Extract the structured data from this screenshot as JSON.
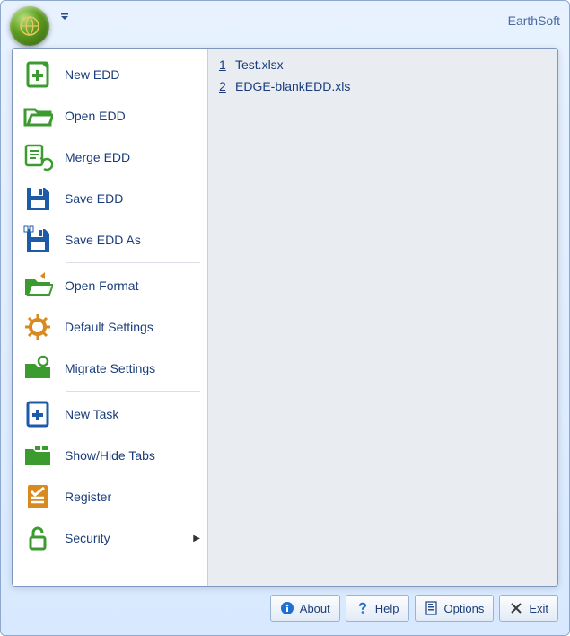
{
  "title": "EarthSoft",
  "menu": {
    "items": [
      {
        "label": "New EDD",
        "icon": "new-edd",
        "color": "green",
        "sep": false,
        "submenu": false
      },
      {
        "label": "Open EDD",
        "icon": "open-edd",
        "color": "green",
        "sep": false,
        "submenu": false
      },
      {
        "label": "Merge EDD",
        "icon": "merge-edd",
        "color": "green",
        "sep": false,
        "submenu": false
      },
      {
        "label": "Save EDD",
        "icon": "save-edd",
        "color": "blue",
        "sep": false,
        "submenu": false
      },
      {
        "label": "Save EDD As",
        "icon": "save-edd-as",
        "color": "blue",
        "sep": false,
        "submenu": false
      },
      {
        "label": "Open Format",
        "icon": "open-format",
        "color": "green",
        "sep": true,
        "submenu": false
      },
      {
        "label": "Default Settings",
        "icon": "default-settings",
        "color": "orange",
        "sep": false,
        "submenu": false
      },
      {
        "label": "Migrate Settings",
        "icon": "migrate-settings",
        "color": "green",
        "sep": false,
        "submenu": false
      },
      {
        "label": "New Task",
        "icon": "new-task",
        "color": "blue",
        "sep": true,
        "submenu": false
      },
      {
        "label": "Show/Hide Tabs",
        "icon": "show-hide-tabs",
        "color": "green",
        "sep": false,
        "submenu": false
      },
      {
        "label": "Register",
        "icon": "register",
        "color": "orange",
        "sep": false,
        "submenu": false
      },
      {
        "label": "Security",
        "icon": "security",
        "color": "green",
        "sep": false,
        "submenu": true
      }
    ]
  },
  "recent": {
    "items": [
      {
        "num": "1",
        "name": "Test.xlsx"
      },
      {
        "num": "2",
        "name": "EDGE-blankEDD.xls"
      }
    ]
  },
  "buttons": {
    "about": "About",
    "help": "Help",
    "options": "Options",
    "exit": "Exit"
  },
  "colors": {
    "green": "#3b9b2e",
    "blue": "#1d5aa8",
    "orange": "#d98a1e"
  }
}
